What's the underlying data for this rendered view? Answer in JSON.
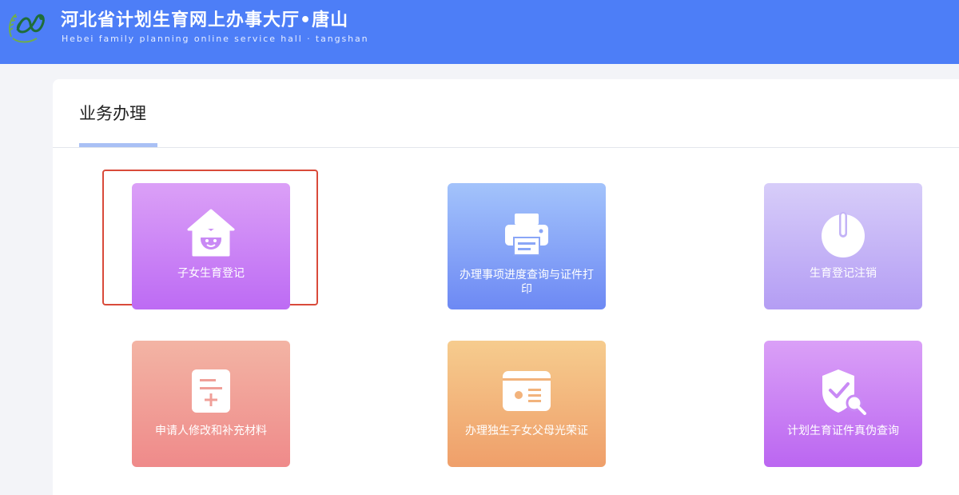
{
  "header": {
    "title": "河北省计划生育网上办事大厅•唐山",
    "subtitle": "Hebei family planning online service hall · tangshan"
  },
  "panel": {
    "tab_title": "业务办理"
  },
  "colors": {
    "header_bg": "#4d7ef7",
    "selection_border": "#d94a3a"
  },
  "services": [
    {
      "label": "子女生育登记",
      "icon": "house-child-icon",
      "selected": true
    },
    {
      "label": "办理事项进度查询与证件打印",
      "icon": "printer-icon"
    },
    {
      "label": "生育登记注销",
      "icon": "power-icon"
    },
    {
      "label": "申请人修改和补充材料",
      "icon": "document-plus-icon"
    },
    {
      "label": "办理独生子女父母光荣证",
      "icon": "id-card-icon"
    },
    {
      "label": "计划生育证件真伪查询",
      "icon": "shield-check-icon"
    }
  ]
}
